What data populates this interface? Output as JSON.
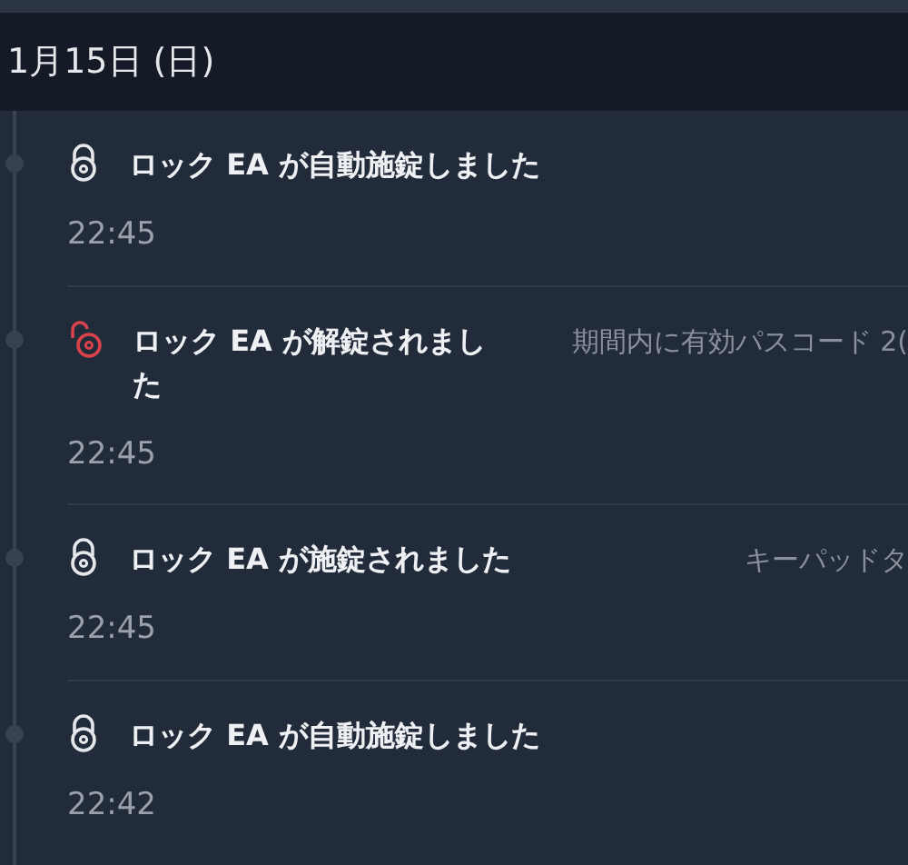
{
  "date_header": "1月15日 (日)",
  "events": [
    {
      "kind": "locked",
      "title": "ロック EA が自動施錠しました",
      "time": "22:45"
    },
    {
      "kind": "unlocked",
      "title": "ロック EA が解錠されました",
      "detail": "期間内に有効パスコード 2(",
      "time": "22:45"
    },
    {
      "kind": "locked",
      "title": "ロック EA が施錠されました",
      "detail": "キーパッドタ",
      "time": "22:45"
    },
    {
      "kind": "locked",
      "title": "ロック EA が自動施錠しました",
      "time": "22:42"
    }
  ]
}
